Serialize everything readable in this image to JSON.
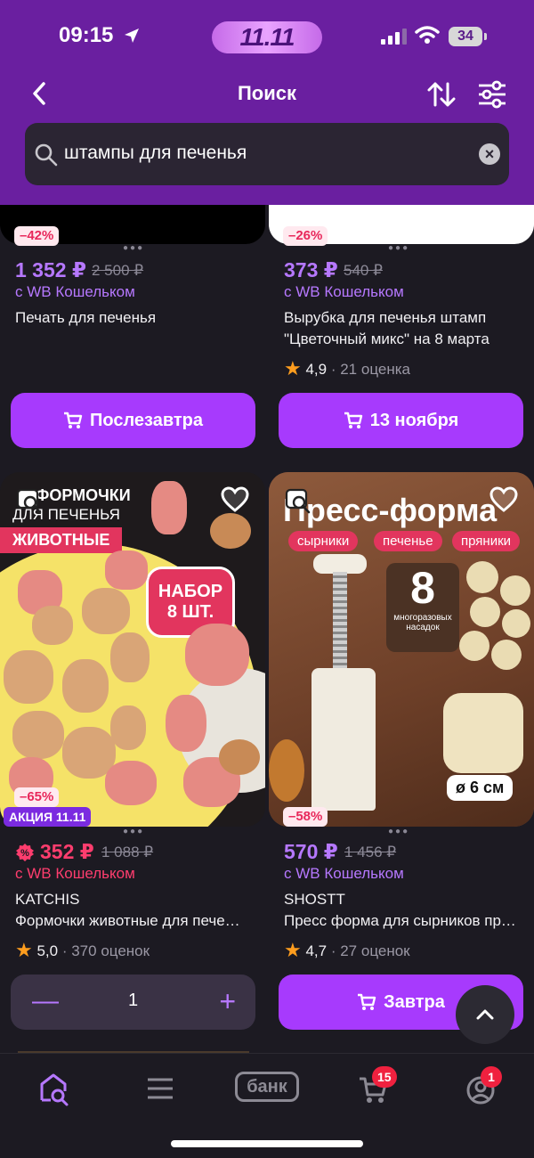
{
  "status": {
    "time": "09:15",
    "promo": "11.11",
    "battery": "34"
  },
  "header": {
    "title": "Поиск"
  },
  "search": {
    "query": "штампы для печенья"
  },
  "cards": [
    {
      "discount": "–42%",
      "price": "1 352 ₽",
      "old_price": "2 500 ₽",
      "wallet": "с WB Кошельком",
      "name": "Печать для печенья",
      "button": "Послезавтра"
    },
    {
      "discount": "–26%",
      "price": "373 ₽",
      "old_price": "540 ₽",
      "wallet": "с WB Кошельком",
      "name_line1": "Вырубка для печенья штамп",
      "name_line2": "\"Цветочный микс\" на 8 марта",
      "rating": "4,9",
      "reviews": "· 21 оценка",
      "button": "13 ноября"
    },
    {
      "discount": "–65%",
      "action": "АКЦИЯ 11.11",
      "price": "352 ₽",
      "old_price": "1 088 ₽",
      "wallet": "с WB Кошельком",
      "brand": "KATCHIS",
      "name": "Формочки животные для печенья",
      "rating": "5,0",
      "reviews": "· 370 оценок",
      "quantity": "1",
      "image": {
        "line1": "ФОРМОЧКИ",
        "line2": "ДЛЯ ПЕЧЕНЬЯ",
        "ribbon": "ЖИВОТНЫЕ",
        "badge1": "НАБОР",
        "badge2": "8 ШТ."
      }
    },
    {
      "discount": "–58%",
      "price": "570 ₽",
      "old_price": "1 456 ₽",
      "wallet": "с WB Кошельком",
      "brand": "SHOSTT",
      "name": "Пресс форма для сырников пряников",
      "rating": "4,7",
      "reviews": "· 27 оценок",
      "button": "Завтра",
      "image": {
        "title": "Пресс-форма",
        "tags": [
          "сырники",
          "печенье",
          "пряники"
        ],
        "count": "8",
        "count_label1": "многоразовых",
        "count_label2": "насадок",
        "size": "ø 6 см"
      }
    }
  ],
  "tabbar": {
    "bank": "банк",
    "cart_count": "15",
    "profile_count": "1"
  },
  "colors": {
    "brand": "#6a1fa0",
    "accent": "#a73afd",
    "sale": "#ff3d6e"
  }
}
